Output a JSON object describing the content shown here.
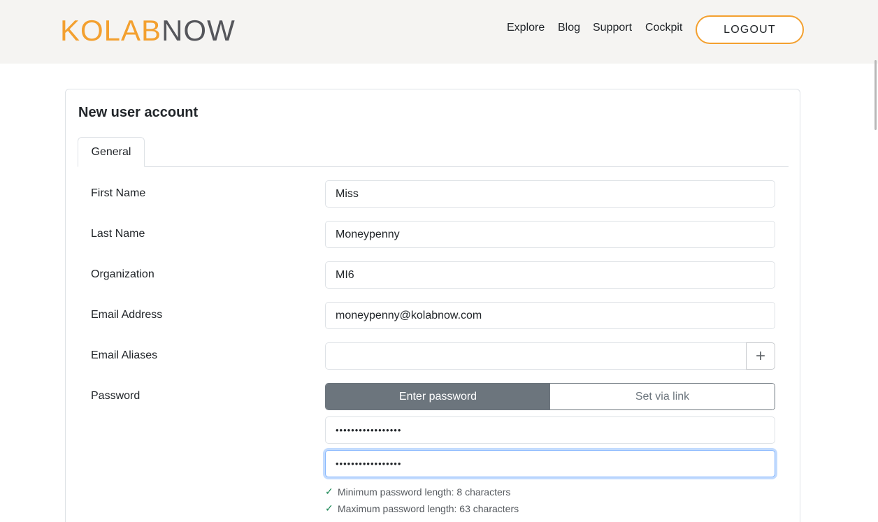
{
  "header": {
    "logo_part1": "KOLAB",
    "logo_part2": "NOW",
    "nav": [
      "Explore",
      "Blog",
      "Support",
      "Cockpit"
    ],
    "logout_label": "LOGOUT"
  },
  "form": {
    "title": "New user account",
    "tab_general": "General",
    "first_name_label": "First Name",
    "first_name_value": "Miss",
    "last_name_label": "Last Name",
    "last_name_value": "Moneypenny",
    "organization_label": "Organization",
    "organization_value": "MI6",
    "email_label": "Email Address",
    "email_value": "moneypenny@kolabnow.com",
    "aliases_label": "Email Aliases",
    "aliases_value": "",
    "add_alias_icon": "+",
    "password_label": "Password",
    "password_mode_enter": "Enter password",
    "password_mode_link": "Set via link",
    "password_value": "•••••••••••••••••",
    "password_confirm_value": "•••••••••••••••••",
    "rules": [
      "Minimum password length: 8 characters",
      "Maximum password length: 63 characters"
    ],
    "check_icon": "✓"
  },
  "colors": {
    "brand_orange": "#f3a02f",
    "brand_gray": "#55565b",
    "secondary": "#6c757d",
    "success": "#198754"
  }
}
